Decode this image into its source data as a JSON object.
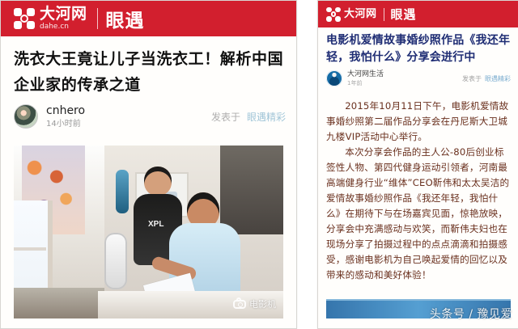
{
  "left_card": {
    "brand": {
      "name": "大河网",
      "domain": "dahe.cn",
      "column": "眼遇"
    },
    "title": "洗衣大王竟让儿子当洗衣工！解析中国企业家的传承之道",
    "author": {
      "name": "cnhero",
      "time": "14小时前"
    },
    "publish_prefix": "发表于",
    "publish_link": "眼遇精彩",
    "photo_watermark": "电影机"
  },
  "right_card": {
    "brand": {
      "name": "大河网",
      "column": "眼遇"
    },
    "title": "电影机爱情故事婚纱照作品《我还年轻，我怕什么》分享会进行中",
    "author": {
      "name": "大河网生活",
      "time": "1年前"
    },
    "publish_prefix": "发表于",
    "publish_link": "眼遇精彩",
    "body": [
      "2015年10月11日下午，电影机爱情故事婚纱照第二届作品分享会在丹尼斯大卫城九楼VIP活动中心举行。",
      "本次分享会作品的主人公-80后创业标签性人物、第四代健身运动引领者，河南最高端健身行业“维体”CEO靳伟和太太吴洁的爱情故事婚纱照作品《我还年轻，我怕什么》在期待下与在场嘉宾见面，惊艳放映，分享会中充满感动与欢笑，而靳伟夫妇也在现场分享了拍摄过程中的点点滴滴和拍摄感受，感谢电影机为自己唤起爱情的回忆以及带来的感动和美好体验！"
    ]
  },
  "footer": {
    "watermark": "头条号 / 豫见爱"
  }
}
